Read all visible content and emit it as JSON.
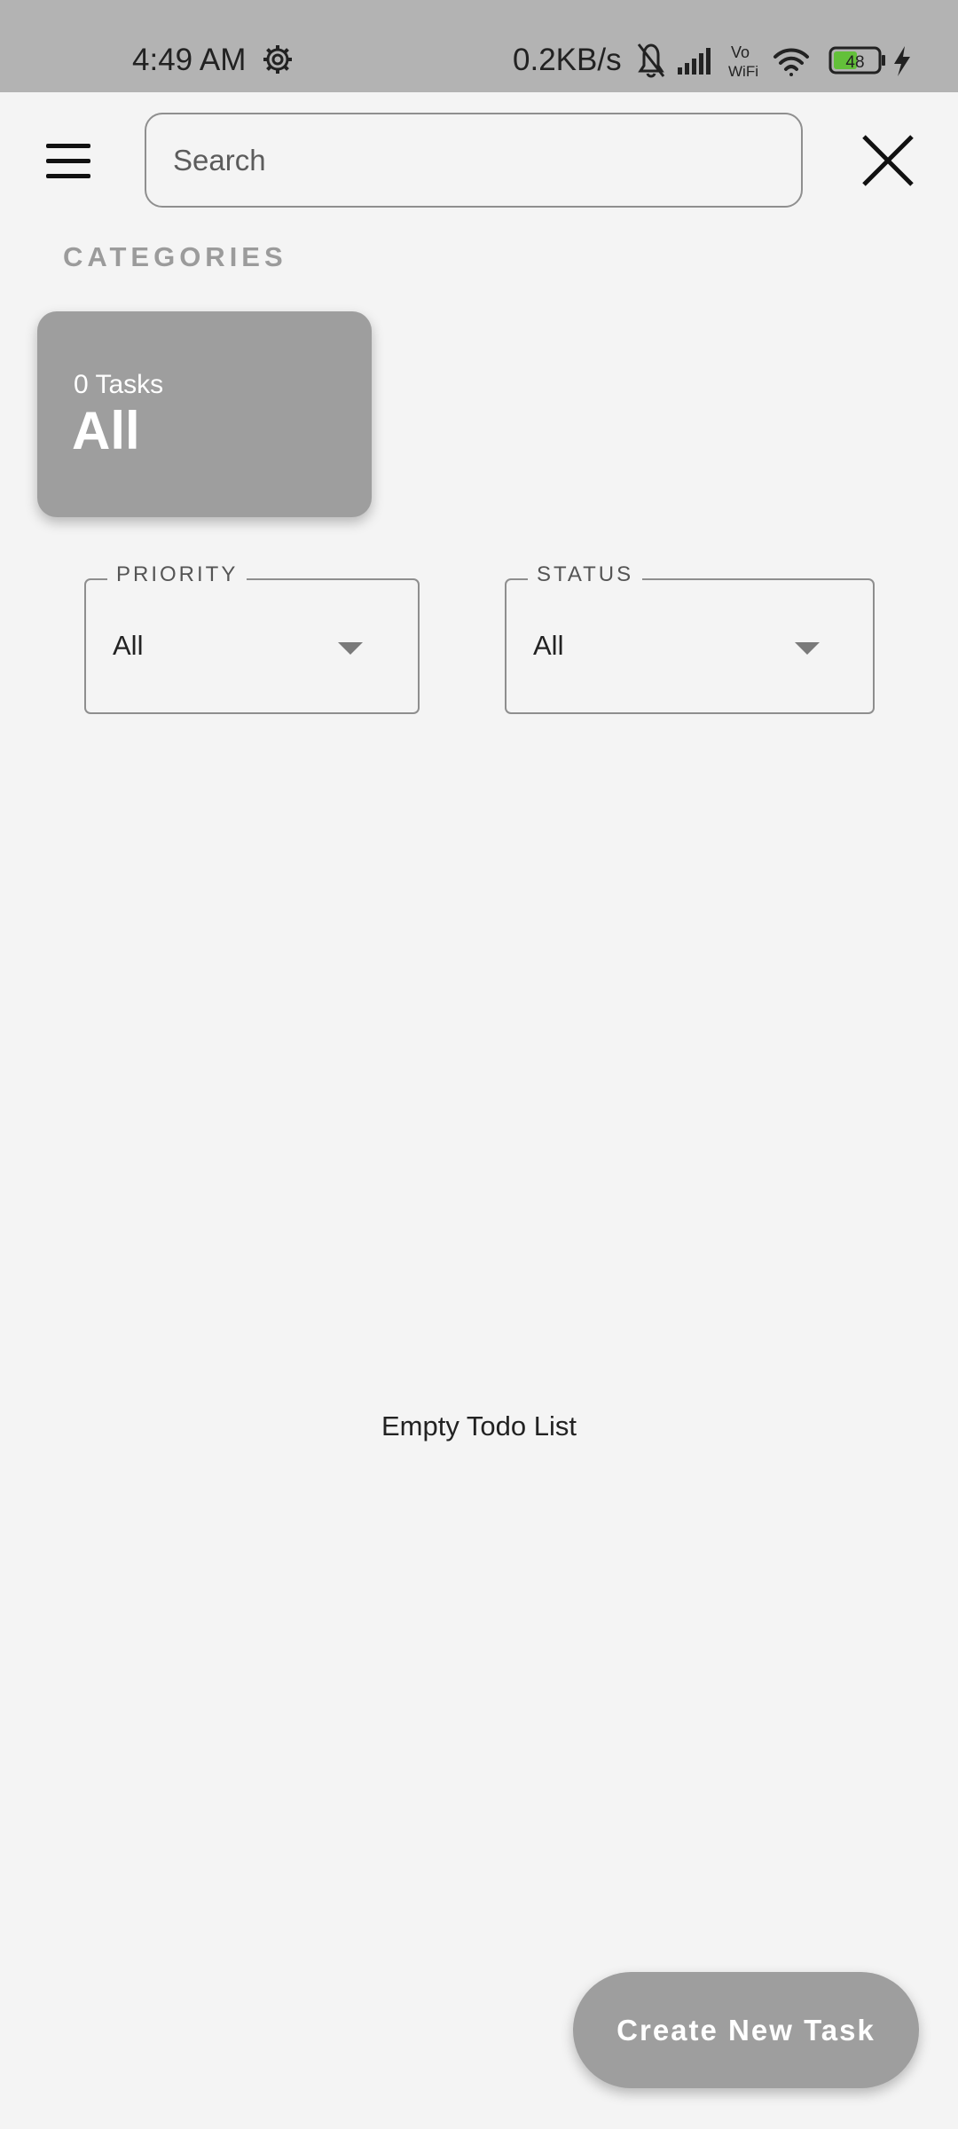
{
  "status_bar": {
    "time": "4:49 AM",
    "net_speed": "0.2KB/s",
    "vowifi_top": "Vo",
    "vowifi_bottom": "WiFi",
    "battery": "48",
    "icons": [
      "settings-gear-icon",
      "bell-muted-icon",
      "signal-bars-icon",
      "vowifi-icon",
      "wifi-icon",
      "battery-icon",
      "charging-bolt-icon"
    ]
  },
  "header": {
    "menu_icon": "hamburger-menu-icon",
    "search_placeholder": "Search",
    "close_icon": "close-x-icon"
  },
  "categories": {
    "title": "CATEGORIES",
    "items": [
      {
        "count_label": "0 Tasks",
        "name": "All"
      }
    ]
  },
  "filters": {
    "priority": {
      "label": "PRIORITY",
      "value": "All"
    },
    "status": {
      "label": "STATUS",
      "value": "All"
    }
  },
  "main": {
    "empty_message": "Empty Todo List"
  },
  "fab": {
    "label": "Create New Task"
  },
  "colors": {
    "status_bar_bg": "#b3b3b3",
    "page_bg": "#f4f4f4",
    "card_bg": "#9e9e9e",
    "fab_bg": "#9e9e9e",
    "battery_fill": "#63c03a"
  }
}
